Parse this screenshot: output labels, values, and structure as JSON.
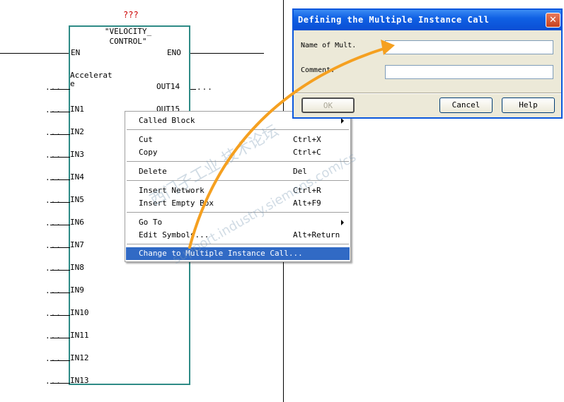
{
  "function_block": {
    "instance_name": "???",
    "name_line1": "\"VELOCITY_",
    "name_line2": "CONTROL\"",
    "pins": {
      "en": "EN",
      "eno": "ENO",
      "in_first_line1": "Accelerat",
      "in_first_line2": "e",
      "inputs": [
        "IN1",
        "IN2",
        "IN3",
        "IN4",
        "IN5",
        "IN6",
        "IN7",
        "IN8",
        "IN9",
        "IN10",
        "IN11",
        "IN12",
        "IN13"
      ],
      "outputs": [
        "OUT14",
        "OUT15"
      ]
    },
    "placeholder": "..."
  },
  "context_menu": {
    "items": [
      {
        "label": "Called Block",
        "shortcut": "",
        "has_submenu": true
      },
      {
        "label": "Cut",
        "shortcut": "Ctrl+X"
      },
      {
        "label": "Copy",
        "shortcut": "Ctrl+C"
      },
      {
        "label": "Delete",
        "shortcut": "Del"
      },
      {
        "label": "Insert Network",
        "shortcut": "Ctrl+R"
      },
      {
        "label": "Insert Empty Box",
        "shortcut": "Alt+F9"
      },
      {
        "label": "Go To",
        "shortcut": "",
        "has_submenu": true
      },
      {
        "label": "Edit Symbols...",
        "shortcut": "Alt+Return"
      },
      {
        "label": "Change to Multiple Instance Call...",
        "shortcut": "",
        "selected": true
      }
    ]
  },
  "dialog": {
    "title": "Defining the Multiple Instance Call",
    "close_icon": "close-icon",
    "name_label": "Name of Mult.",
    "name_value": "",
    "comment_label": "Comment:",
    "comment_value": "",
    "ok_label": "OK",
    "cancel_label": "Cancel",
    "help_label": "Help"
  },
  "overlay": {
    "watermark_cn": "西门子工业 技术论坛",
    "watermark_url": "support.industry.siemens.com/cs"
  },
  "colors": {
    "box_border": "#2e8b86",
    "instance_name": "#cc0000",
    "menu_selection": "#316ac5",
    "title_bar": "#0a57dd",
    "annotation_arrow": "#f5a020"
  }
}
